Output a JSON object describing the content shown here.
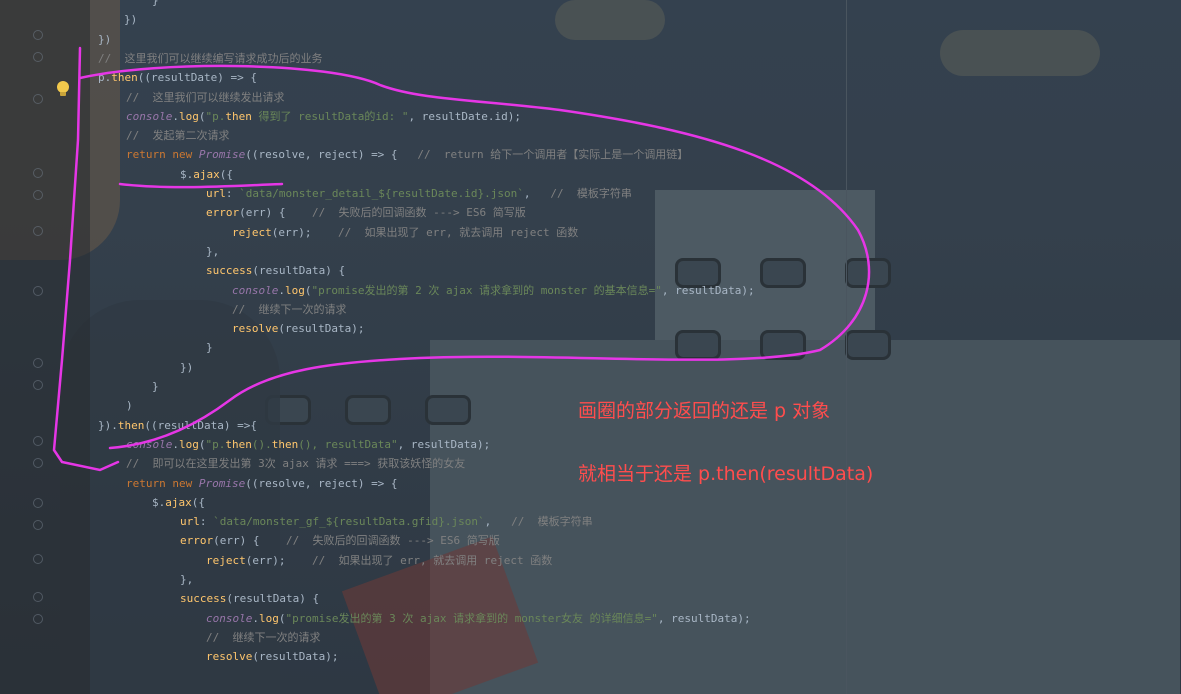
{
  "code_lines": [
    {
      "text": "}"
    },
    {
      "text": "})"
    },
    {
      "text": "})"
    },
    {
      "text": "//  这里我们可以继续编写请求成功后的业务"
    },
    {
      "text": "p.then((resultDate) => {"
    },
    {
      "text": "//  这里我们可以继续发出请求"
    },
    {
      "text": "console.log(\"p.then 得到了 resultData的id: \", resultDate.id);"
    },
    {
      "text": "//  发起第二次请求"
    },
    {
      "text": "return new Promise((resolve, reject) => {   //  return 给下一个调用者【实际上是一个调用链】"
    },
    {
      "text": "$.ajax({"
    },
    {
      "text": "url: `data/monster_detail_${resultDate.id}.json`,   //  模板字符串"
    },
    {
      "text": "error(err) {    //  失败后的回调函数 ---> ES6 简写版"
    },
    {
      "text": "reject(err);    //  如果出现了 err, 就去调用 reject 函数"
    },
    {
      "text": "},"
    },
    {
      "text": "success(resultData) {"
    },
    {
      "text": "console.log(\"promise发出的第 2 次 ajax 请求拿到的 monster 的基本信息=\", resultData);"
    },
    {
      "text": "//  继续下一次的请求"
    },
    {
      "text": "resolve(resultData);"
    },
    {
      "text": "}"
    },
    {
      "text": "})"
    },
    {
      "text": "}"
    },
    {
      "text": ")"
    },
    {
      "text": "}).then((resultData) =>{"
    },
    {
      "text": "console.log(\"p.then().then(), resultData\", resultData);"
    },
    {
      "text": "//  即可以在这里发出第 3次 ajax 请求 ===> 获取该妖怪的女友"
    },
    {
      "text": "return new Promise((resolve, reject) => {"
    },
    {
      "text": "$.ajax({"
    },
    {
      "text": "url: `data/monster_gf_${resultData.gfid}.json`,   //  模板字符串"
    },
    {
      "text": "error(err) {    //  失败后的回调函数 ---> ES6 简写版"
    },
    {
      "text": "reject(err);    //  如果出现了 err, 就去调用 reject 函数"
    },
    {
      "text": "},"
    },
    {
      "text": "success(resultData) {"
    },
    {
      "text": "console.log(\"promise发出的第 3 次 ajax 请求拿到的 monster女友 的详细信息=\", resultData);"
    },
    {
      "text": "//  继续下一次的请求"
    },
    {
      "text": "resolve(resultData);"
    }
  ],
  "annotations": {
    "note1": "画圈的部分返回的还是 p 对象",
    "note2": "就相当于还是 p.then(resultData)"
  },
  "colors": {
    "annotation_red": "#ff4d4d",
    "scribble_magenta": "#e636e6",
    "keyword": "#cc7832",
    "function": "#ffc66d",
    "string": "#6a8759",
    "comment": "#808080"
  },
  "icons": [
    "lightbulb-icon"
  ]
}
